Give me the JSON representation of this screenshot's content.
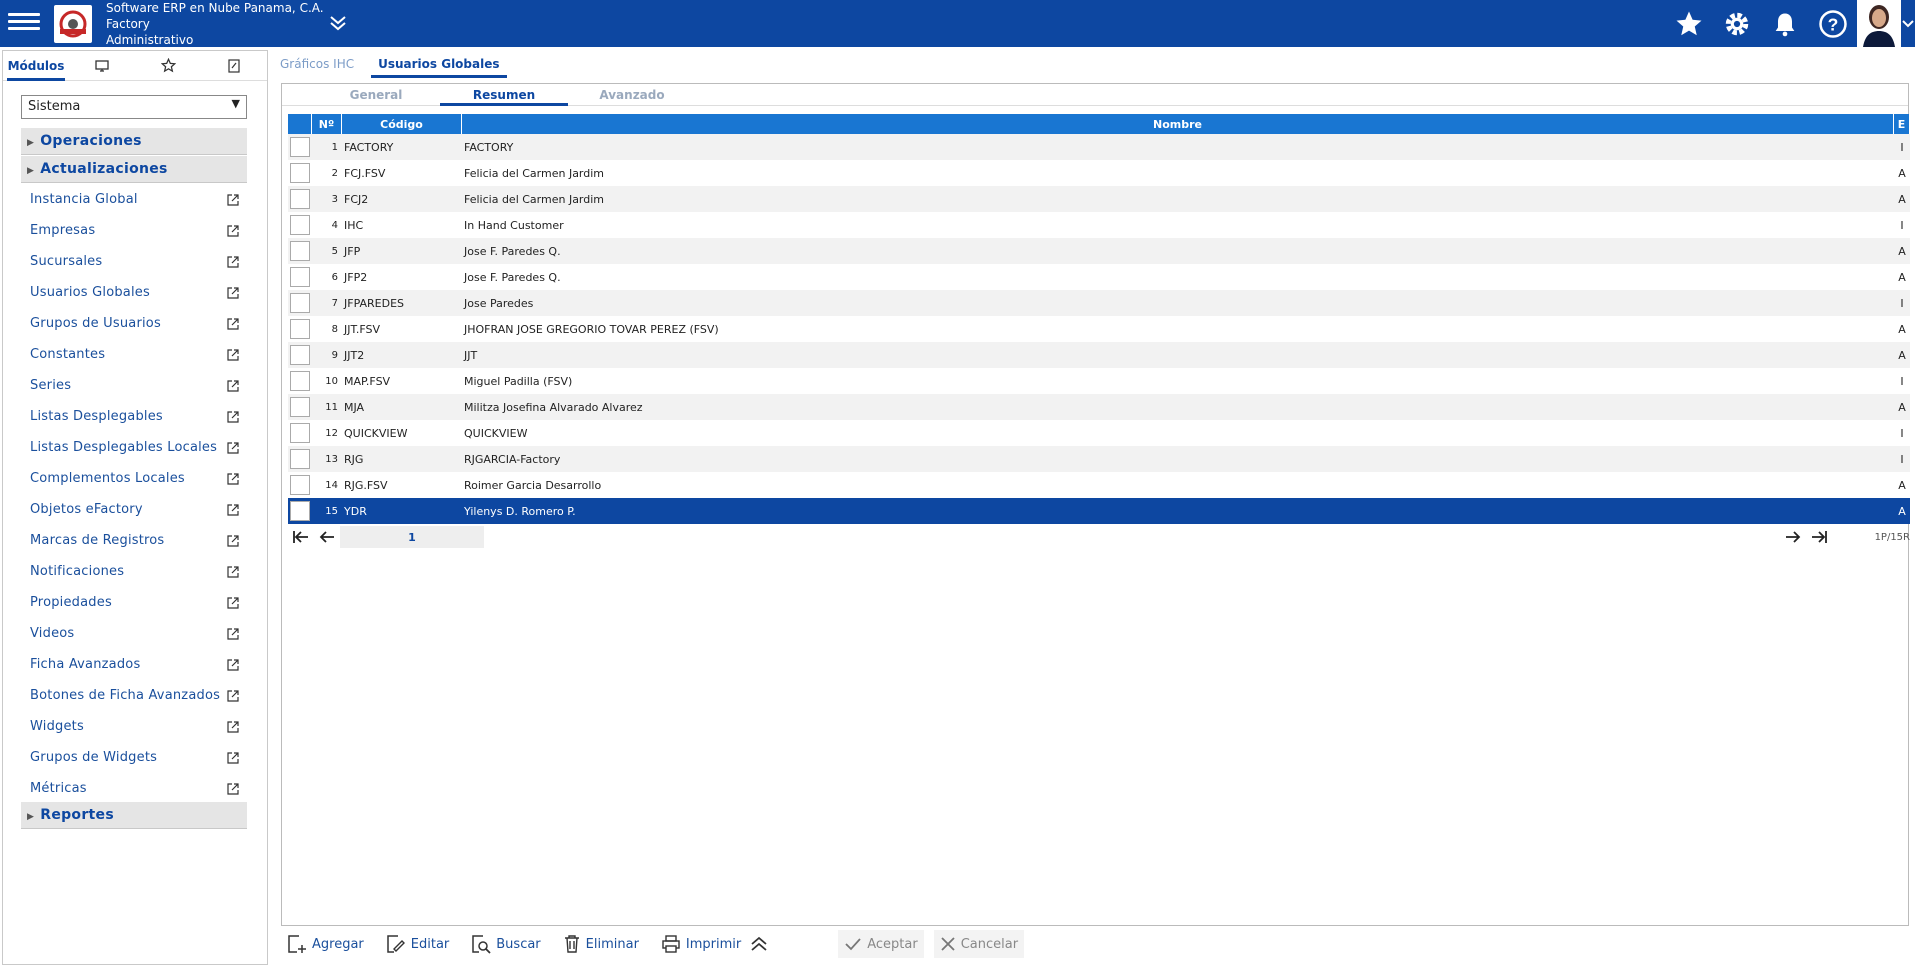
{
  "header": {
    "company_line1": "Software ERP en Nube Panama, C.A.",
    "company_line2": "Factory",
    "company_line3": "Administrativo"
  },
  "left_tabs": [
    "Módulos"
  ],
  "module_select": {
    "value": "Sistema"
  },
  "sections": {
    "operaciones": "Operaciones",
    "actualizaciones": "Actualizaciones",
    "reportes": "Reportes"
  },
  "menu_items": [
    "Instancia Global",
    "Empresas",
    "Sucursales",
    "Usuarios Globales",
    "Grupos de Usuarios",
    "Constantes",
    "Series",
    "Listas Desplegables",
    "Listas Desplegables Locales",
    "Complementos Locales",
    "Objetos eFactory",
    "Marcas de Registros",
    "Notificaciones",
    "Propiedades",
    "Videos",
    "Ficha Avanzados",
    "Botones de Ficha Avanzados",
    "Widgets",
    "Grupos de Widgets",
    "Métricas"
  ],
  "main_tabs": [
    "Gráficos IHC",
    "Usuarios Globales"
  ],
  "sub_tabs": [
    "General",
    "Resumen",
    "Avanzado"
  ],
  "grid": {
    "headers": {
      "num": "Nº",
      "code": "Código",
      "name": "Nombre",
      "status": "E"
    },
    "rows": [
      {
        "num": "1",
        "code": "FACTORY",
        "name": "FACTORY",
        "status": "I"
      },
      {
        "num": "2",
        "code": "FCJ.FSV",
        "name": "Felicia del Carmen Jardim",
        "status": "A"
      },
      {
        "num": "3",
        "code": "FCJ2",
        "name": "Felicia del Carmen Jardim",
        "status": "A"
      },
      {
        "num": "4",
        "code": "IHC",
        "name": "In Hand Customer",
        "status": "I"
      },
      {
        "num": "5",
        "code": "JFP",
        "name": "Jose F. Paredes Q.",
        "status": "A"
      },
      {
        "num": "6",
        "code": "JFP2",
        "name": "Jose F. Paredes Q.",
        "status": "A"
      },
      {
        "num": "7",
        "code": "JFPAREDES",
        "name": "Jose Paredes",
        "status": "I"
      },
      {
        "num": "8",
        "code": "JJT.FSV",
        "name": "JHOFRAN JOSE GREGORIO TOVAR PEREZ (FSV)",
        "status": "A"
      },
      {
        "num": "9",
        "code": "JJT2",
        "name": "JJT",
        "status": "A"
      },
      {
        "num": "10",
        "code": "MAP.FSV",
        "name": "Miguel Padilla (FSV)",
        "status": "I"
      },
      {
        "num": "11",
        "code": "MJA",
        "name": "Militza Josefina Alvarado Alvarez",
        "status": "A"
      },
      {
        "num": "12",
        "code": "QUICKVIEW",
        "name": "QUICKVIEW",
        "status": "I"
      },
      {
        "num": "13",
        "code": "RJG",
        "name": "RJGARCIA-Factory",
        "status": "I"
      },
      {
        "num": "14",
        "code": "RJG.FSV",
        "name": "Roimer Garcia Desarrollo",
        "status": "A"
      },
      {
        "num": "15",
        "code": "YDR",
        "name": "Yilenys D. Romero P.",
        "status": "A"
      }
    ],
    "selected_row": 15,
    "page": "1",
    "page_info": "1P/15R"
  },
  "toolbar": {
    "add": "Agregar",
    "edit": "Editar",
    "search": "Buscar",
    "delete": "Eliminar",
    "print": "Imprimir",
    "accept": "Aceptar",
    "cancel": "Cancelar"
  },
  "colors": {
    "primary": "#0d47a1",
    "grid_header": "#1976d2",
    "row_alt": "#f2f2f2"
  }
}
